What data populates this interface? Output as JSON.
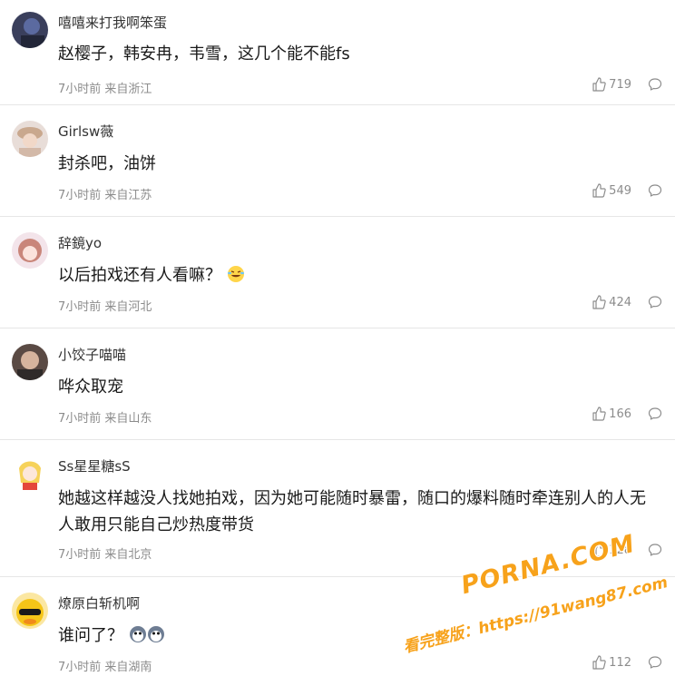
{
  "comments": [
    {
      "username": "嘻嘻来打我啊笨蛋",
      "text": "赵樱子，韩安冉，韦雪，这几个能不能fs",
      "time": "7小时前",
      "location": "来自浙江",
      "likes": "719"
    },
    {
      "username": "Girlsw薇",
      "text": "封杀吧，油饼",
      "time": "7小时前",
      "location": "来自江苏",
      "likes": "549"
    },
    {
      "username": "辞鏡yo",
      "text": "以后拍戏还有人看嘛？",
      "time": "7小时前",
      "location": "来自河北",
      "likes": "424"
    },
    {
      "username": "小饺子喵喵",
      "text": "哗众取宠",
      "time": "7小时前",
      "location": "来自山东",
      "likes": "166"
    },
    {
      "username": "Ss星星糖sS",
      "text": "她越这样越没人找她拍戏，因为她可能随时暴雷，随口的爆料随时牵连别人的人无人敢用只能自己炒热度带货",
      "time": "7小时前",
      "location": "来自北京",
      "likes": "128"
    },
    {
      "username": "燎原白斩机啊",
      "text": "谁问了？",
      "time": "7小时前",
      "location": "来自湖南",
      "likes": "112"
    }
  ],
  "watermark": {
    "line1": "PORNA.COM",
    "line2": "看完整版：https://91wang87.com"
  },
  "colors": {
    "meta": "#8c8c8c",
    "watermark": "#f7a21b"
  }
}
